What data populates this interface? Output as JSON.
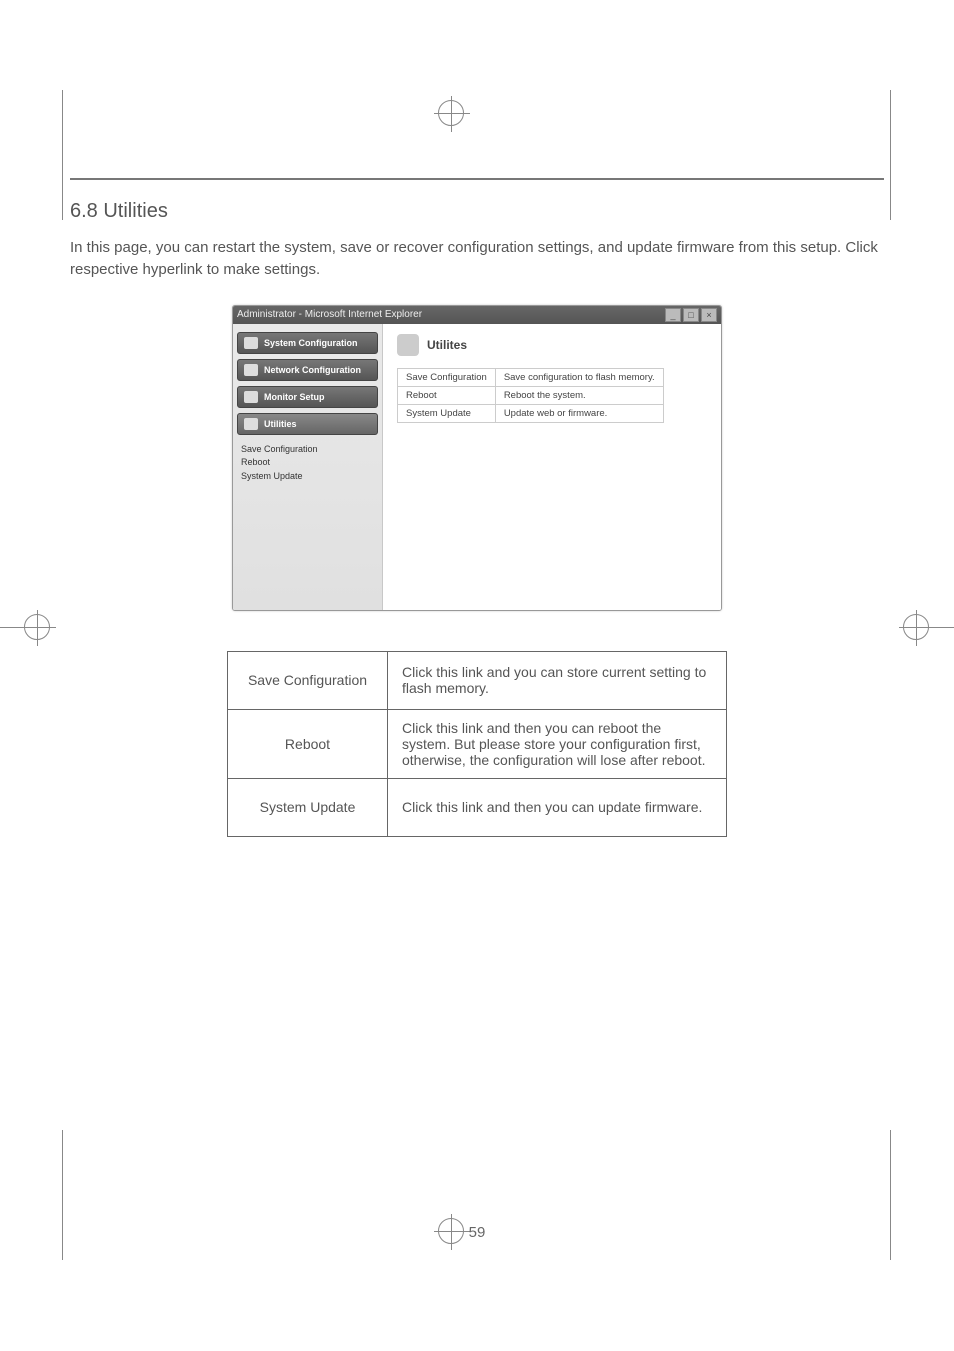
{
  "section": {
    "title": "6.8  Utilities",
    "body": "In this page, you can restart the system, save or recover configuration settings, and update firmware from this setup. Click respective hyperlink to make settings."
  },
  "window": {
    "title": "Administrator - Microsoft Internet Explorer",
    "nav": {
      "items": [
        "System Configuration",
        "Network Configuration",
        "Monitor Setup",
        "Utilities"
      ],
      "sub": [
        "Save Configuration",
        "Reboot",
        "System Update"
      ]
    },
    "content": {
      "heading": "Utilites",
      "rows": [
        {
          "k": "Save Configuration",
          "v": "Save configuration to flash memory."
        },
        {
          "k": "Reboot",
          "v": "Reboot the system."
        },
        {
          "k": "System Update",
          "v": "Update web or firmware."
        }
      ]
    },
    "win_buttons": {
      "min": "_",
      "max": "□",
      "close": "×"
    }
  },
  "desc": [
    {
      "k": "Save Configuration",
      "v": "Click this link and you can store current setting to flash memory."
    },
    {
      "k": "Reboot",
      "v": "Click this link and then you can reboot the system. But please store your configuration first, otherwise, the configuration will lose after reboot."
    },
    {
      "k": "System Update",
      "v": "Click this link and then you can update firmware."
    }
  ],
  "page_number": "59"
}
